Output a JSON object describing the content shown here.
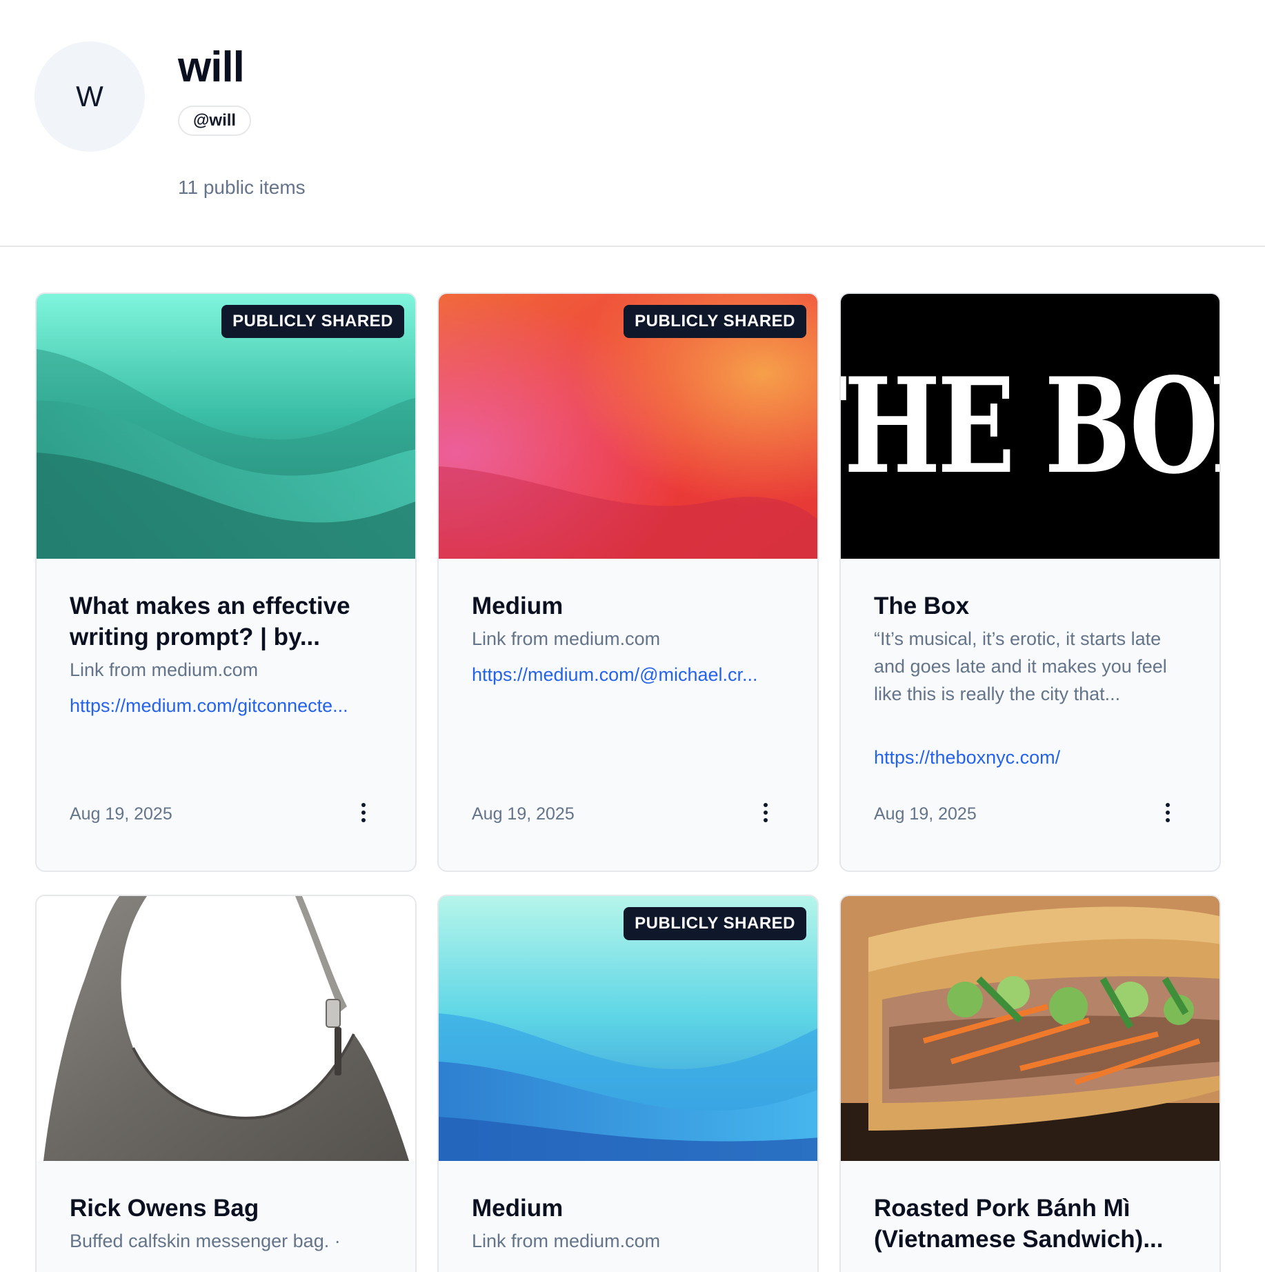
{
  "profile": {
    "avatar_initial": "W",
    "name": "will",
    "handle": "@will",
    "item_count": "11 public items"
  },
  "cards": [
    {
      "badge": "PUBLICLY SHARED",
      "title": "What makes an effective writing prompt? | by...",
      "description": "Link from medium.com",
      "link": "https://medium.com/gitconnecte...",
      "date": "Aug 19, 2025"
    },
    {
      "badge": "PUBLICLY SHARED",
      "title": "Medium",
      "description": "Link from medium.com",
      "link": "https://medium.com/@michael.cr...",
      "date": "Aug 19, 2025"
    },
    {
      "image_text": "THE BOX",
      "title": "The Box",
      "description": "“It’s musical, it’s erotic, it starts late and goes late and it makes you feel like this is really the city that...",
      "link": "https://theboxnyc.com/",
      "date": "Aug 19, 2025"
    },
    {
      "title": "Rick Owens Bag",
      "description": "Buffed calfskin messenger bag. ·"
    },
    {
      "badge": "PUBLICLY SHARED",
      "title": "Medium",
      "description": "Link from medium.com"
    },
    {
      "title": "Roasted Pork Bánh Mì (Vietnamese Sandwich)..."
    }
  ],
  "icons": {
    "menu": "more-vertical-icon"
  },
  "colors": {
    "badge_bg": "#0f172a",
    "link": "#2563eb",
    "muted": "#64748b",
    "card_bg": "#f8fafc"
  }
}
